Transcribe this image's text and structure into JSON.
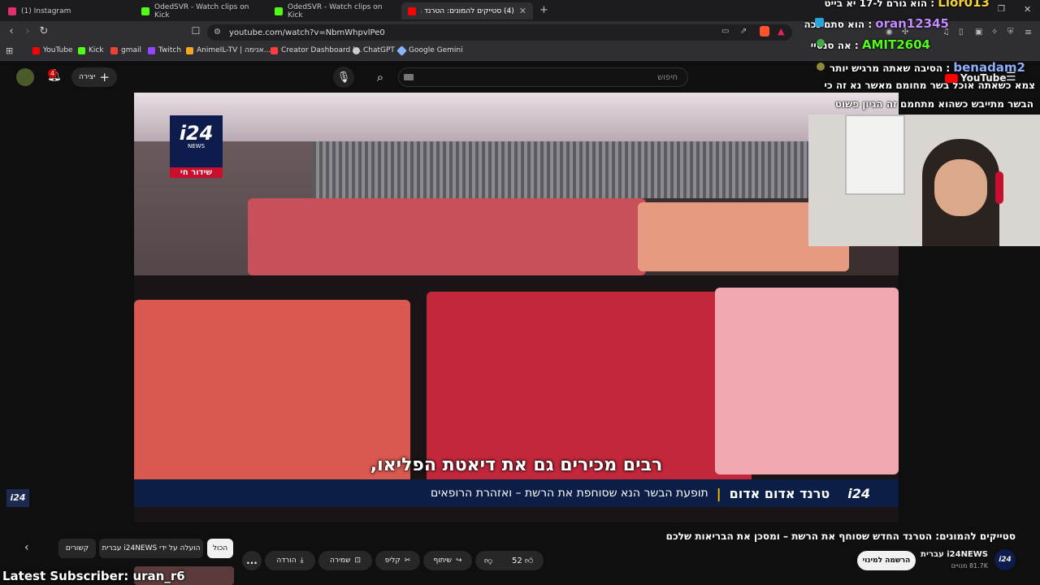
{
  "tabs": [
    {
      "label": "(1) Instagram",
      "color": "#e1306c"
    },
    {
      "label": "OdedSVR - Watch clips on Kick",
      "color": "#53fc18"
    },
    {
      "label": "OdedSVR - Watch clips on Kick",
      "color": "#53fc18"
    },
    {
      "label": "(4) סטייקים להמונים: הטרנד הח",
      "color": "#ff0000"
    }
  ],
  "url": "youtube.com/watch?v=NbmWhpvlPe0",
  "bookmarks": [
    {
      "label": "YouTube",
      "color": "#ff0000"
    },
    {
      "label": "Kick",
      "color": "#53fc18"
    },
    {
      "label": "gmail",
      "color": "#ea4335"
    },
    {
      "label": "Twitch",
      "color": "#9146ff"
    },
    {
      "label": "AnimeIL-TV | אנימה...",
      "color": "#f5a623"
    },
    {
      "label": "Creator Dashboard |...",
      "color": "#ff3d3d"
    },
    {
      "label": "ChatGPT",
      "color": "#cccccc"
    },
    {
      "label": "Google Gemini",
      "color": "#8ab4f8"
    }
  ],
  "header": {
    "create_label": "יצירה",
    "notif_count": "4",
    "search_placeholder": "חיפוש"
  },
  "video": {
    "logo_text": "i24",
    "logo_sub": "NEWS",
    "live_label": "שידור חי",
    "subtitle": "רבים מכירים גם את דיאטת הפליאו,",
    "ticker_tag": "טרנד אדום אדום",
    "ticker_text": "תופעת הבשר הנא שסוחפת את הרשת – ואזהרת הרופאים",
    "ticker_logo": "i24",
    "side_logo": "i24"
  },
  "meta": {
    "title": "סטייקים להמונים: הטרנד החדש שסוחף את הרשת – ומסכן את הבריאות שלכם",
    "channel_name": "i24NEWS עברית",
    "subscribers": "81.7K מנויים",
    "subscribe_label": "הרשמה למינוי",
    "like_count": "52",
    "share_label": "שיתוף",
    "clip_label": "קליפ",
    "save_label": "שמירה",
    "download_label": "הורדה",
    "more_label": "..."
  },
  "filters": [
    "הכול",
    "הועלה על ידי i24NEWS עברית",
    "קשורים"
  ],
  "chat": [
    {
      "user": "Lior013",
      "user_color": "#f2d13a",
      "text": "הוא גורם ל-17 יא בייט"
    },
    {
      "user": "oran12345",
      "user_color": "#c58cff",
      "text": "הוא סתם נכה"
    },
    {
      "user": "AMIT2604",
      "user_color": "#53fc18",
      "text": "אה סנסיי"
    },
    {
      "user": "benadam2",
      "user_color": "#8fb0ff",
      "text": "הסיבה שאתה מרגיש יותר"
    },
    {
      "user": "",
      "user_color": "#ffffff",
      "text": "צמא כשאתה אוכל בשר מחומם מאשר נא זה כי"
    },
    {
      "user": "",
      "user_color": "#ffffff",
      "text": "הבשר מתייבש כשהוא מתחמם זה הגיון פשוט"
    }
  ],
  "overlay": {
    "latest_subscriber": "Latest Subscriber: uran_r6",
    "yt_brand": "YouTube"
  }
}
